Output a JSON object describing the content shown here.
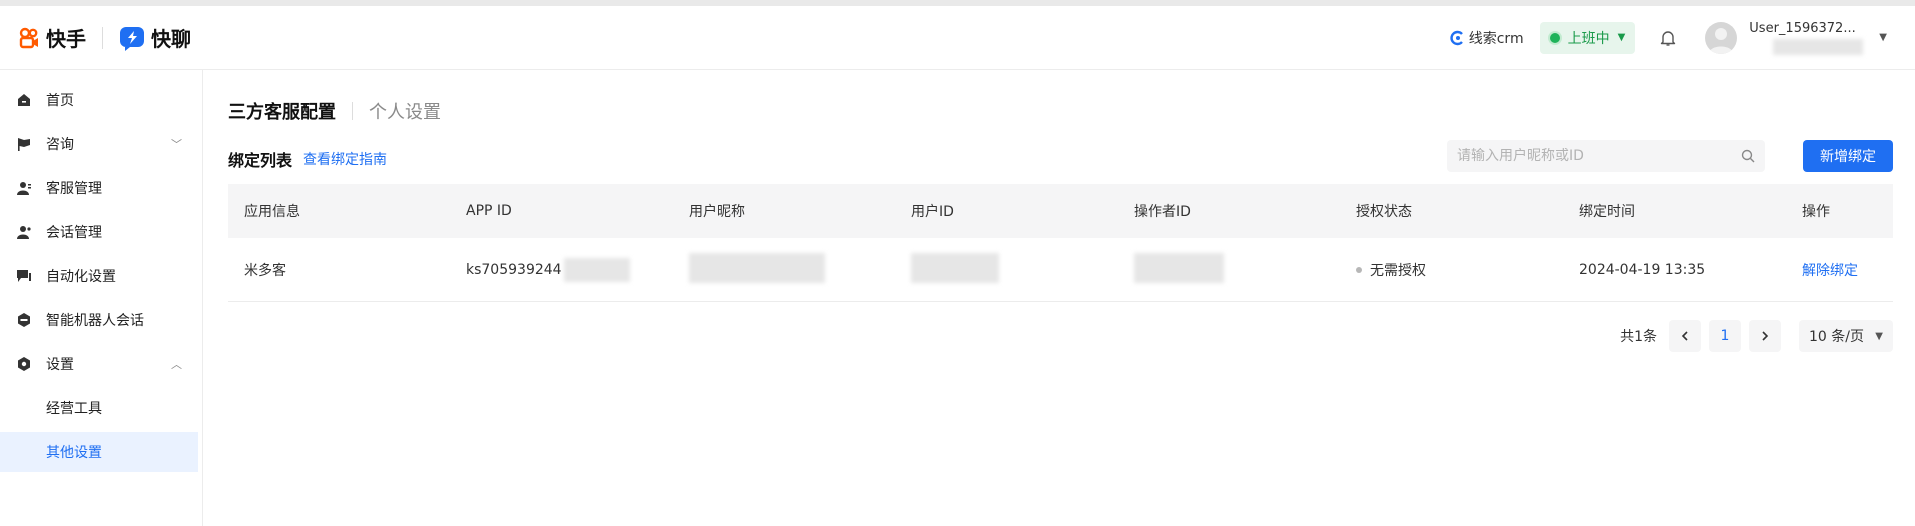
{
  "header": {
    "brand_kuaishou": "快手",
    "brand_kuailiao": "快聊",
    "crm_label": "线索crm",
    "status_label": "上班中",
    "user_name": "User_1596372..."
  },
  "sidebar": {
    "items": [
      {
        "label": "首页",
        "icon": "home-icon"
      },
      {
        "label": "咨询",
        "icon": "flag-icon"
      },
      {
        "label": "客服管理",
        "icon": "user-icon"
      },
      {
        "label": "会话管理",
        "icon": "user-chat-icon"
      },
      {
        "label": "自动化设置",
        "icon": "chat-icon"
      },
      {
        "label": "智能机器人会话",
        "icon": "robot-icon"
      },
      {
        "label": "设置",
        "icon": "gear-icon"
      }
    ],
    "sub_items": [
      {
        "label": "经营工具"
      },
      {
        "label": "其他设置"
      }
    ]
  },
  "main": {
    "tab_active": "三方客服配置",
    "tab_other": "个人设置",
    "list_title": "绑定列表",
    "guide_link": "查看绑定指南",
    "search_placeholder": "请输入用户昵称或ID",
    "add_button": "新增绑定",
    "columns": [
      "应用信息",
      "APP ID",
      "用户昵称",
      "用户ID",
      "操作者ID",
      "授权状态",
      "绑定时间",
      "操作"
    ],
    "rows": [
      {
        "app": "米多客",
        "app_id": "ks705939244",
        "auth_status": "无需授权",
        "bind_time": "2024-04-19 13:35",
        "action": "解除绑定"
      }
    ],
    "pagination": {
      "total": "共1条",
      "current_page": "1",
      "page_size": "10 条/页"
    }
  },
  "colors": {
    "accent": "#1f6ff2",
    "status_green": "#1a9a4a",
    "status_bg": "#e7f5ec"
  }
}
